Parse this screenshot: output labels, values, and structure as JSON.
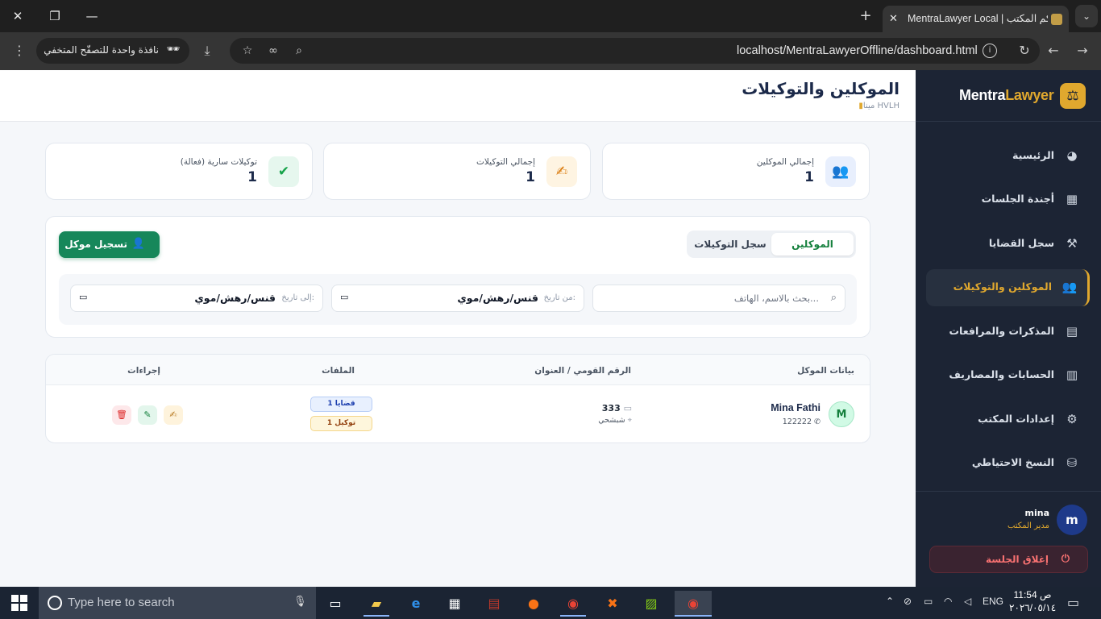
{
  "browser": {
    "tab_title": "MentraLawyer Local | كم المكتب",
    "url": "localhost/MentraLawyerOffline/dashboard.html",
    "guest_label": "نافذة واحدة للتصفّح المتخفي"
  },
  "sidebar": {
    "brand_main": "Mentra",
    "brand_accent": "Lawyer",
    "items": [
      {
        "label": "الرئيسية",
        "icon": "pie-chart-icon"
      },
      {
        "label": "أجندة الجلسات",
        "icon": "calendar-icon"
      },
      {
        "label": "سجل القضايا",
        "icon": "gavel-icon"
      },
      {
        "label": "الموكلين والتوكيلات",
        "icon": "users-icon",
        "active": true
      },
      {
        "label": "المذكرات والمرافعات",
        "icon": "file-icon"
      },
      {
        "label": "الحسابات والمصاريف",
        "icon": "invoice-icon"
      },
      {
        "label": "إعدادات المكتب",
        "icon": "gear-icon"
      },
      {
        "label": "النسخ الاحتياطي",
        "icon": "database-icon"
      }
    ],
    "user": {
      "name": "mina",
      "role": "مدير المكتب",
      "initial": "m"
    },
    "logout_label": "إغلاق الجلسة"
  },
  "header": {
    "title": "الموكلين والتوكيلات",
    "office": "مينا HVLH"
  },
  "stats": [
    {
      "label": "إجمالي الموكلين",
      "value": "1",
      "icon": "users-icon",
      "color": "#2563eb"
    },
    {
      "label": "إجمالي التوكيلات",
      "value": "1",
      "icon": "signature-icon",
      "color": "#d97706"
    },
    {
      "label": "توكيلات سارية (فعالة)",
      "value": "1",
      "icon": "check-circle-icon",
      "color": "#16a34a"
    }
  ],
  "tabs": {
    "clients": "الموكلين",
    "poa": "سجل التوكيلات"
  },
  "add_button": "تسجيل موكل",
  "filters": {
    "search_placeholder": "بحث بالاسم، الهاتف...",
    "from_label": "من تاريخ:",
    "from_value": "قنس/رهش/موي",
    "to_label": "إلى تاريخ:",
    "to_value": "قنس/رهش/موي"
  },
  "table": {
    "columns": [
      "بيانات الموكل",
      "الرقم القومي / العنوان",
      "الملفات",
      "إجراءات"
    ],
    "rows": [
      {
        "initial": "M",
        "name": "Mina Fathi",
        "phone": "122222",
        "national_id": "333",
        "address": "شبشحي",
        "cases_badge": "1 قضايا",
        "poa_badge": "1 توكيل"
      }
    ]
  },
  "taskbar": {
    "search_placeholder": "Type here to search",
    "lang": "ENG",
    "time": "ص 11:54",
    "date": "٢٠٢٦/٠٥/١٤"
  },
  "colors": {
    "sidebar_bg": "#1c2434",
    "accent_gold": "#e0a82e",
    "primary_green": "#16875a",
    "title_navy": "#1c2a4a"
  }
}
